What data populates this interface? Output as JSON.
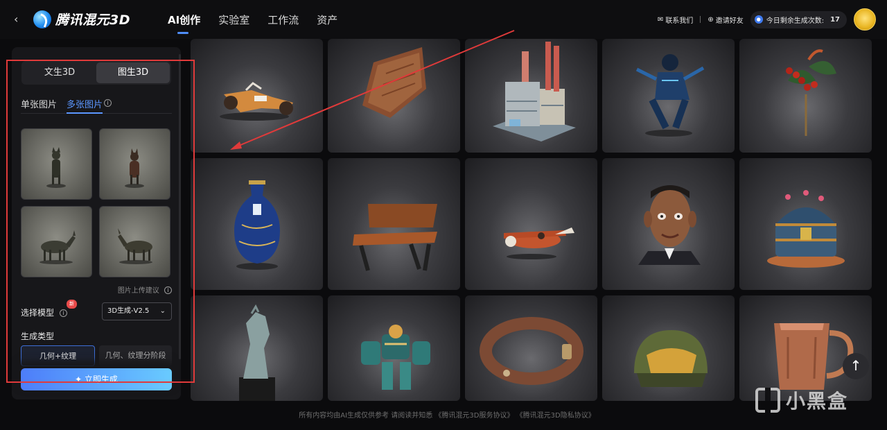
{
  "header": {
    "back_icon": "chevron-left-icon",
    "logo_text": "腾讯混元3D",
    "nav": [
      {
        "label": "AI创作",
        "active": true
      },
      {
        "label": "实验室",
        "active": false
      },
      {
        "label": "工作流",
        "active": false
      },
      {
        "label": "资产",
        "active": false
      }
    ],
    "contact_label": "联系我们",
    "invite_label": "邀请好友",
    "quota_label": "今日剩余生成次数:",
    "quota_value": "17"
  },
  "panel": {
    "mode_tabs": [
      {
        "label": "文生3D",
        "active": false
      },
      {
        "label": "图生3D",
        "active": true
      }
    ],
    "image_tabs": [
      {
        "label": "单张图片",
        "active": false
      },
      {
        "label": "多张图片",
        "active": true
      }
    ],
    "upload_hint": "图片上传建议",
    "model_label": "选择模型",
    "new_badge": "新",
    "model_selected": "3D生成-V2.5",
    "gen_type_label": "生成类型",
    "gen_types": [
      {
        "label": "几何+纹理",
        "active": true
      },
      {
        "label": "几何、纹理分阶段",
        "active": false
      }
    ],
    "generate_label": "✦ 立即生成"
  },
  "gallery": [
    "motorcycle",
    "wooden-tray",
    "factory",
    "ninja-robot",
    "holly-branch",
    "blue-vase",
    "wooden-bench",
    "toy-airplane",
    "cartoon-head",
    "treasure-chest",
    "horse-statue",
    "mech-robot",
    "leather-collar",
    "helmet",
    "copper-mug"
  ],
  "scroll_top_icon": "arrow-up-icon",
  "watermark_text": "小黑盒",
  "footer_text": "所有内容均由AI生成仅供参考 请阅读并知悉 《腾讯混元3D服务协议》 《腾讯混元3D隐私协议》",
  "colors": {
    "accent": "#4f8df7",
    "annotation": "#e03a3a",
    "badge": "#e84a4a"
  }
}
